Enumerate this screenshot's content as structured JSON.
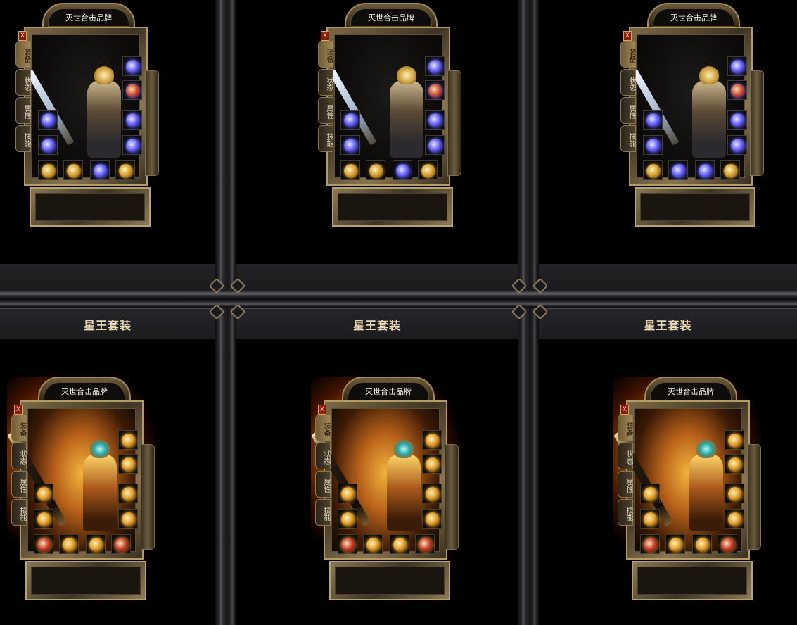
{
  "panel": {
    "cap_text": "灭世合击品牌",
    "close_label": "X",
    "tabs": [
      "装备",
      "状态",
      "属性",
      "技能"
    ]
  },
  "sections": {
    "bottom_title": "星王套装"
  },
  "cells": [
    {
      "row": "top",
      "theme": "blue",
      "has_title": false
    },
    {
      "row": "top",
      "theme": "blue",
      "has_title": false
    },
    {
      "row": "top",
      "theme": "blue",
      "has_title": false
    },
    {
      "row": "bottom",
      "theme": "fire",
      "has_title": true
    },
    {
      "row": "bottom",
      "theme": "fire",
      "has_title": true
    },
    {
      "row": "bottom",
      "theme": "fire",
      "has_title": true
    }
  ],
  "icons": {
    "close": "close-icon",
    "slot_items": [
      "necklace-icon",
      "bracelet-icon",
      "ring-icon",
      "medal-icon",
      "belt-icon",
      "boots-icon",
      "gem-icon"
    ]
  },
  "colors": {
    "title_text": "#e8d7b0",
    "frame_gold": "#b49b66",
    "close_red": "#8a1d12"
  }
}
